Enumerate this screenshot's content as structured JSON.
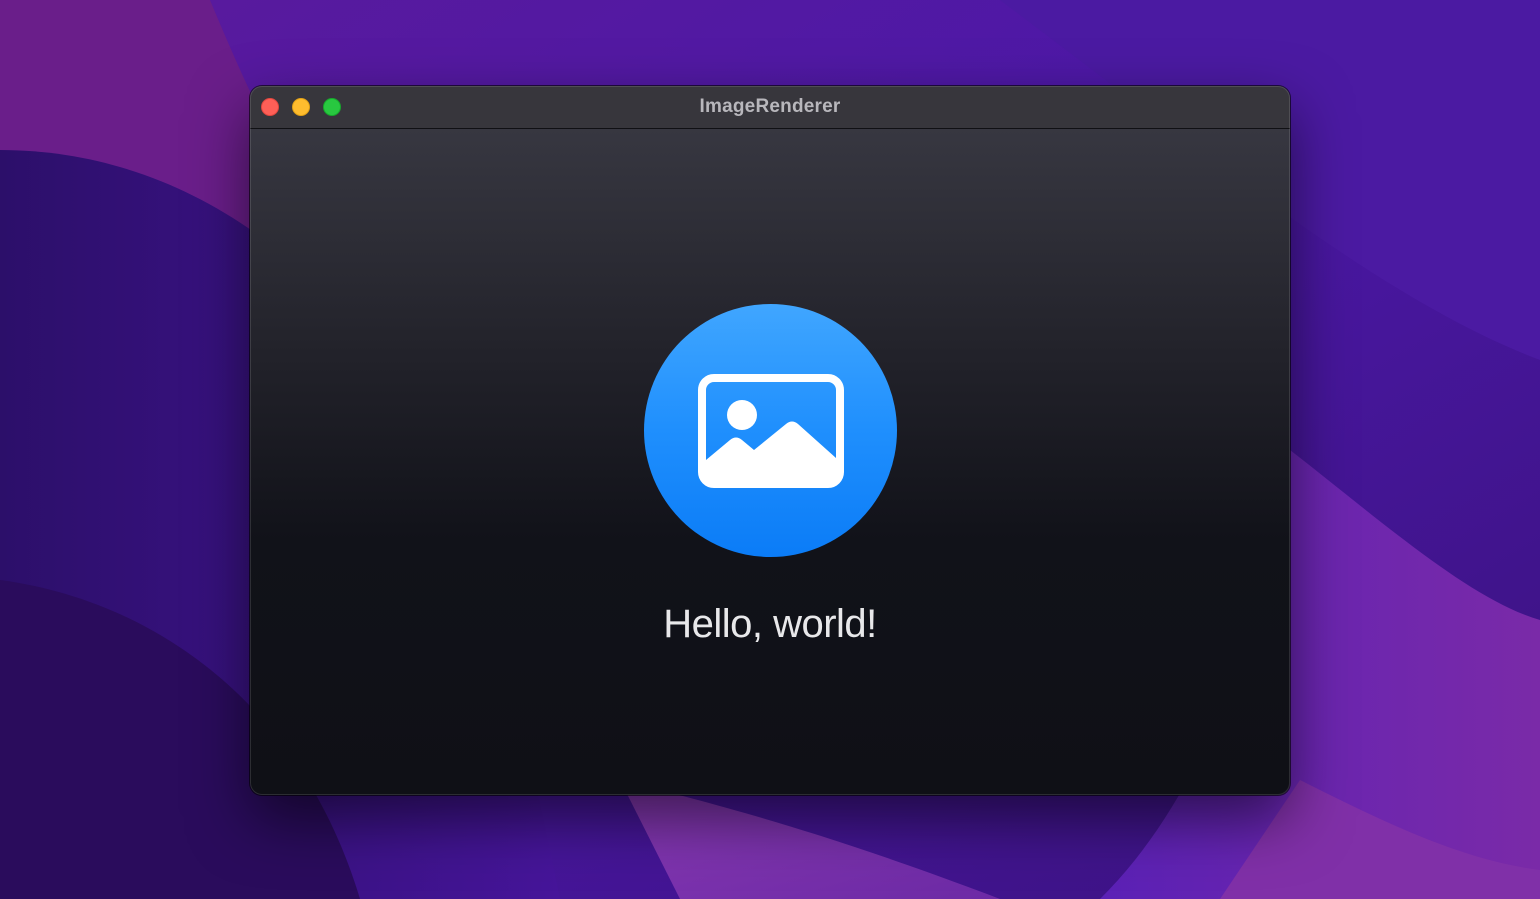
{
  "window": {
    "title": "ImageRenderer"
  },
  "content": {
    "icon": "photo-icon",
    "greeting": "Hello, world!"
  },
  "colors": {
    "accent_blue": "#1f8ffd",
    "close": "#fe5f57",
    "minimize": "#febc2e",
    "zoom": "#28c840",
    "wallpaper_purple": "#4a1796"
  }
}
